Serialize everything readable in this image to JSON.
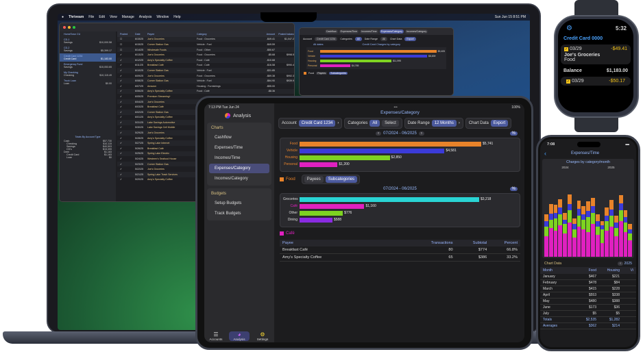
{
  "mac": {
    "menu": [
      "Thriveam",
      "File",
      "Edit",
      "View",
      "Manage",
      "Analysis",
      "Window",
      "Help"
    ],
    "clock": "Sun Jun 15  8:51 PM",
    "sidebar": [
      {
        "name": "HomeTown CU",
        "sub": "",
        "amt": ""
      },
      {
        "name": "CD-1",
        "sub": "Savings",
        "amt": "$10,000.58"
      },
      {
        "name": "CD-2",
        "sub": "Savings",
        "amt": "$5,399.17"
      },
      {
        "name": "Credit Card 1234",
        "sub": "Credit Card",
        "amt": "$1,183.00"
      },
      {
        "name": "Emergency Fund",
        "sub": "Savings",
        "amt": "$15,053.65"
      },
      {
        "name": "My Checking",
        "sub": "Checking",
        "amt": "$10,115.49"
      },
      {
        "name": "Truck Loan",
        "sub": "Loan",
        "amt": "$0.00"
      }
    ],
    "totals_title": "Totals By Account Type",
    "totals": [
      [
        "Cash",
        "$57,730"
      ],
      [
        "Checking",
        "$10,115"
      ],
      [
        "Savings",
        "$40,503"
      ],
      [
        "CD's",
        "$15,399"
      ],
      [
        "Debt",
        "$1,183"
      ],
      [
        "Credit Card",
        "$1,183"
      ],
      [
        "Loan",
        "$0"
      ]
    ],
    "columns": [
      "Posted",
      "Date",
      "Payee",
      "Category",
      "Amount",
      "Posted balance"
    ],
    "rows": [
      [
        "6/15/25",
        "Joe's Groceries",
        "Food : Groceries",
        "-$49.41",
        "$1,047.23"
      ],
      [
        "6/15/25",
        "Corner Station Gas",
        "Vehicle : Fuel",
        "-$49.59",
        ""
      ],
      [
        "6/14/25",
        "Wholesale Foods",
        "Food : Other",
        "-$50.67",
        ""
      ],
      [
        "6/13/25",
        "Joe's Groceries",
        "Food : Groceries",
        "-$5.68",
        "$998.50"
      ],
      [
        "6/12/25",
        "Amy's Specialty Coffee",
        "Food : Café",
        "-$10.68",
        ""
      ],
      [
        "6/11/25",
        "Breakfast Café",
        "Food : Café",
        "-$16.58",
        "$990.48"
      ],
      [
        "6/10/25",
        "Corner Station Gas",
        "Vehicle : Fuel",
        "-$31.85",
        ""
      ],
      [
        "6/09/25",
        "Joe's Groceries",
        "Food : Groceries",
        "-$69.38",
        "$992.34"
      ],
      [
        "6/08/25",
        "Corner Station Gas",
        "Vehicle : Fuel",
        "-$64.90",
        "$939.96"
      ],
      [
        "6/07/25",
        "Amazon",
        "Housing : Furnishings",
        "-$55.00",
        ""
      ],
      [
        "6/06/25",
        "Amy's Specialty Coffee",
        "Food : Café",
        "-$8.36",
        ""
      ],
      [
        "6/05/25",
        "Premium Streaming+",
        "",
        "",
        ""
      ],
      [
        "6/04/25",
        "Joe's Groceries",
        "",
        "",
        ""
      ],
      [
        "6/03/25",
        "Breakfast Café",
        "",
        "",
        ""
      ],
      [
        "6/02/25",
        "Corner Station Gas",
        "",
        "",
        ""
      ],
      [
        "6/01/25",
        "Amy's Specialty Coffee",
        "",
        "",
        ""
      ],
      [
        "5/31/25",
        "Lake Savings Automotive",
        "",
        "",
        ""
      ],
      [
        "5/30/25",
        "Lake Savings Cell Mobile",
        "",
        "",
        ""
      ],
      [
        "5/29/25",
        "Joe's Groceries",
        "",
        "",
        ""
      ],
      [
        "5/28/25",
        "Amy's Specialty Coffee",
        "",
        "",
        ""
      ],
      [
        "5/27/25",
        "Spring Lake Internet",
        "",
        "",
        ""
      ],
      [
        "5/26/25",
        "Breakfast Café",
        "",
        "",
        ""
      ],
      [
        "5/25/25",
        "Spring Lake Electric",
        "",
        "",
        ""
      ],
      [
        "5/24/25",
        "Westeen's Seafood House",
        "",
        "",
        ""
      ],
      [
        "5/23/25",
        "Corner Station Gas",
        "",
        "",
        ""
      ],
      [
        "5/22/25",
        "Joe's Groceries",
        "",
        "",
        ""
      ],
      [
        "5/21/25",
        "Spring Lake Trash Services",
        "",
        "",
        ""
      ],
      [
        "5/20/25",
        "Amy's Specialty Coffee",
        "",
        "",
        ""
      ]
    ],
    "mini_tabs": [
      "Cashflow",
      "Expenses/Time",
      "Incomes/Time",
      "Expenses/Category",
      "Incomes/Category"
    ],
    "mini_account": "Credit Card 1234",
    "mini_categories": "All",
    "mini_range": "All",
    "mini_chart_title": "Credit Card Charges by category",
    "mini_alldates": "All dates",
    "mini_bars": [
      [
        "Food",
        "$9,405"
      ],
      [
        "Vehicle",
        "$8,839"
      ],
      [
        "Housing",
        "$11,595"
      ],
      [
        "Personal",
        "$4,765"
      ]
    ],
    "mini_food": "Food",
    "mini_payees": "Payees",
    "mini_subcats": "Subcategories"
  },
  "ipad": {
    "time": "7:13 PM  Tue Jun 24",
    "battery": "100%",
    "app_title": "Analysis",
    "charts_h": "Charts",
    "charts": [
      "Cashflow",
      "Expenses/Time",
      "Incomes/Time",
      "Expenses/Category",
      "Incomes/Category"
    ],
    "budgets_h": "Budgets",
    "budgets": [
      "Setup Budgets",
      "Track Budgets"
    ],
    "tabs": [
      "Accounts",
      "Analysis",
      "Settings"
    ],
    "title": "Expenses/Category",
    "account_lbl": "Account",
    "account_val": "Credit Card 1234",
    "cat_lbl": "Categories",
    "cat_all": "All",
    "cat_select": "Select",
    "range_lbl": "Date Range",
    "range_val": "12 Months",
    "chartdata": "Chart Data",
    "export": "Export",
    "period1": "07/2024 - 06/2025",
    "period2": "07/2024 - 06/2025",
    "pct": "%",
    "food_tag": "Food",
    "payees": "Payees",
    "subcats": "Subcategories",
    "cafe_tag": "Café",
    "grid_cols": [
      "Payee",
      "Transactions",
      "Subtotal",
      "Percent"
    ],
    "grid_rows": [
      [
        "Breakfast Café",
        "80",
        "$774",
        "66.8%"
      ],
      [
        "Amy's Specialty Coffee",
        "65",
        "$386",
        "33.2%"
      ]
    ]
  },
  "chart_data": [
    {
      "type": "bar",
      "title": "",
      "categories": [
        "Food",
        "Vehicle",
        "Housing",
        "Personal"
      ],
      "values": [
        5741,
        4581,
        2850,
        1200
      ],
      "labels": [
        "$5,741",
        "$4,581",
        "$2,850",
        "$1,200"
      ],
      "colors": [
        "#e8832a",
        "#3b3bd9",
        "#7ed321",
        "#e020c0"
      ]
    },
    {
      "type": "bar",
      "title": "",
      "categories": [
        "Groceries",
        "Café",
        "Other",
        "Dining"
      ],
      "values": [
        3218,
        1160,
        776,
        588
      ],
      "labels": [
        "$3,218",
        "$1,160",
        "$776",
        "$588"
      ],
      "colors": [
        "#2ad4d4",
        "#e020c0",
        "#7ed321",
        "#8a2be2"
      ]
    }
  ],
  "watch": {
    "title": "Credit Card 0000",
    "time": "5:32",
    "r1_date": "03/29",
    "r1_amt": "-$49.41",
    "r1_payee": "Joe's Groceries",
    "r1_cat": "Food",
    "bal_lbl": "Balance",
    "bal_amt": "$1,183.00",
    "r2_date": "03/29",
    "r2_amt": "-$50.17"
  },
  "phone": {
    "time": "7:08",
    "title": "Expenses/Time",
    "chart_title": "Charges by category/month",
    "years": [
      "2024",
      "2025"
    ],
    "chartdata": "Chart Data",
    "year": "2025",
    "cols": [
      "Month",
      "Food",
      "Housing",
      "Vi"
    ],
    "rows": [
      [
        "January",
        "$467",
        "$221"
      ],
      [
        "February",
        "$478",
        "$84"
      ],
      [
        "March",
        "$415",
        "$228"
      ],
      [
        "April",
        "$553",
        "$338"
      ],
      [
        "May",
        "$480",
        "$388"
      ],
      [
        "June",
        "$173",
        "$36"
      ],
      [
        "July",
        "$5",
        "$5"
      ],
      [
        "Totals",
        "$2,535",
        "$1,282"
      ],
      [
        "Averages",
        "$362",
        "$214"
      ]
    ]
  }
}
